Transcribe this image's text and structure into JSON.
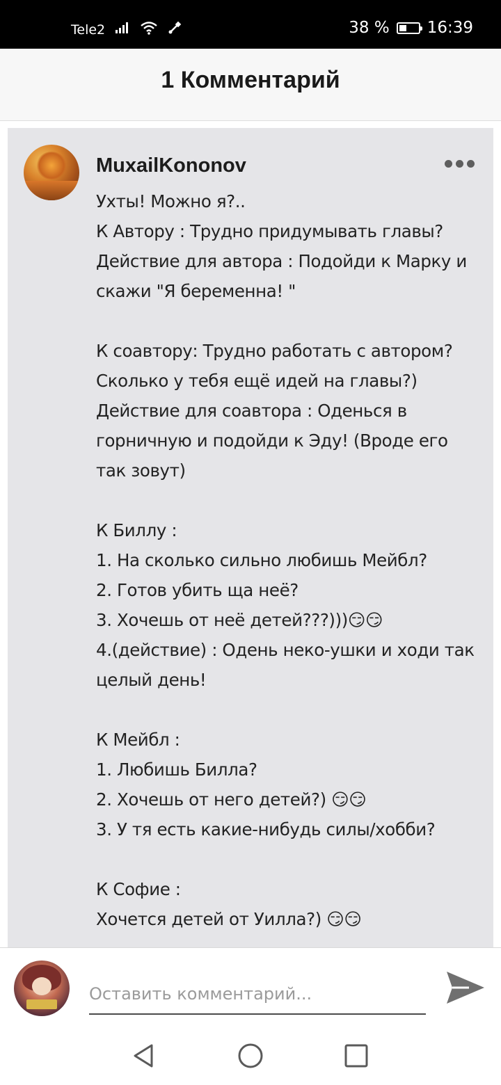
{
  "status_bar": {
    "carrier": "Tele2",
    "battery_percent": "38 %",
    "battery_level": 0.38,
    "time": "16:39",
    "icons": [
      "signal-icon",
      "wifi-icon",
      "usb-icon",
      "battery-icon"
    ]
  },
  "header": {
    "title": "1 Комментарий"
  },
  "comment": {
    "author": "MuxailKononov",
    "text": "Ухты! Можно я?..\nК Автору : Трудно придумывать главы?\nДействие для автора : Подойди к Марку и скажи \"Я беременна! \"\n\nК соавтору: Трудно работать с автором? Сколько у тебя ещё идей на главы?)\nДействие для соавтора : Оденься в горничную и подойди к Эду! (Вроде его так зовут)\n\nК Биллу :\n1. На сколько сильно любишь Мейбл?\n2. Готов убить ща неё?\n3. Хочешь от неё детей???)))😏😏\n4.(действие) : Одень неко-ушки и ходи так целый день!\n\nК Мейбл :\n1. Любишь Билла?\n2. Хочешь от него детей?) 😏😏\n3. У тя есть какие-нибудь силы/хобби?\n\nК Софие :\nХочется детей от Уилла?) 😏😏",
    "more_icon": "more-horizontal-icon"
  },
  "composer": {
    "placeholder": "Оставить комментарий...",
    "value": "",
    "send_icon": "send-icon"
  },
  "nav": {
    "icons": [
      "back-icon",
      "home-icon",
      "recents-icon"
    ]
  },
  "colors": {
    "card_background": "#e5e5e8",
    "header_background": "#f7f7f7",
    "status_bar": "#000000"
  }
}
